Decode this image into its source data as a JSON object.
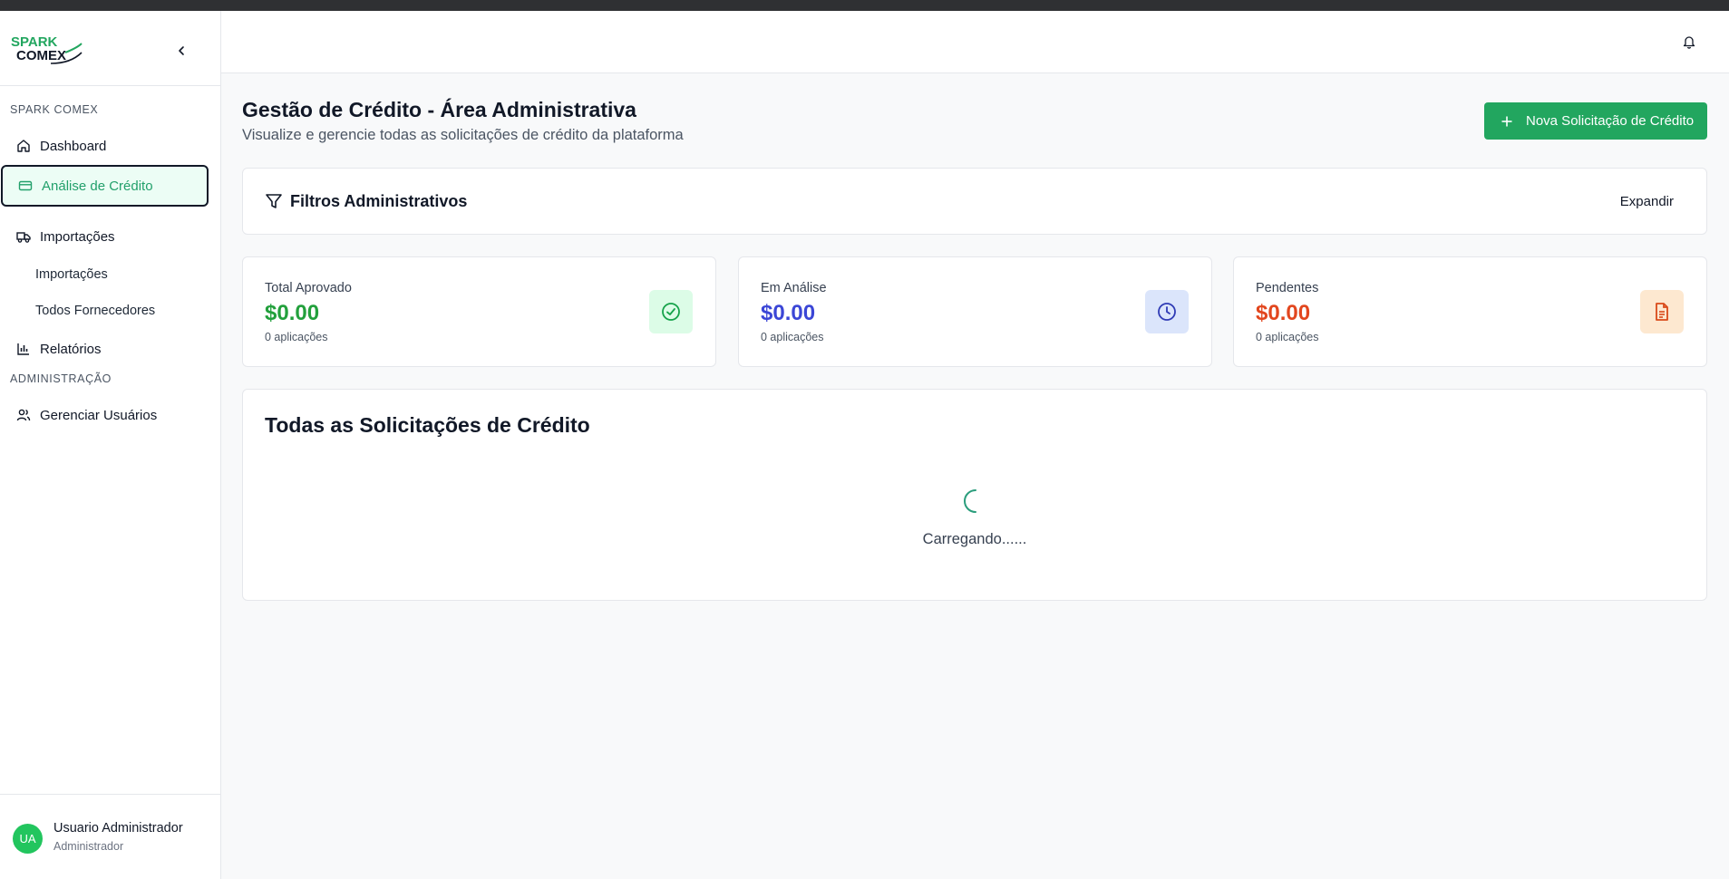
{
  "brand": {
    "logo_line1": "SPARK",
    "logo_line2": "COMEX"
  },
  "sidebar": {
    "section1": "SPARK COMEX",
    "items": [
      {
        "label": "Dashboard"
      },
      {
        "label": "Análise de Crédito"
      },
      {
        "label": "Importações"
      },
      {
        "label": "Importações"
      },
      {
        "label": "Todos Fornecedores"
      },
      {
        "label": "Relatórios"
      }
    ],
    "section2": "ADMINISTRAÇÃO",
    "admin_items": [
      {
        "label": "Gerenciar Usuários"
      }
    ]
  },
  "user": {
    "initials": "UA",
    "name": "Usuario Administrador",
    "role": "Administrador"
  },
  "header": {
    "title": "Gestão de Crédito - Área Administrativa",
    "subtitle": "Visualize e gerencie todas as solicitações de crédito da plataforma",
    "new_button": "Nova Solicitação de Crédito"
  },
  "filters": {
    "title": "Filtros Administrativos",
    "expand": "Expandir"
  },
  "stats": [
    {
      "label": "Total Aprovado",
      "value": "$0.00",
      "sub": "0 aplicações",
      "color": "#22a03c",
      "icon": "check-circle-icon"
    },
    {
      "label": "Em Análise",
      "value": "$0.00",
      "sub": "0 aplicações",
      "color": "#3b46d6",
      "icon": "clock-icon"
    },
    {
      "label": "Pendentes",
      "value": "$0.00",
      "sub": "0 aplicações",
      "color": "#e2461e",
      "icon": "document-icon"
    }
  ],
  "requests": {
    "title": "Todas as Solicitações de Crédito",
    "loading": "Carregando......"
  },
  "colors": {
    "accent": "#22a65f",
    "active_bg": "#ecfdf5"
  }
}
